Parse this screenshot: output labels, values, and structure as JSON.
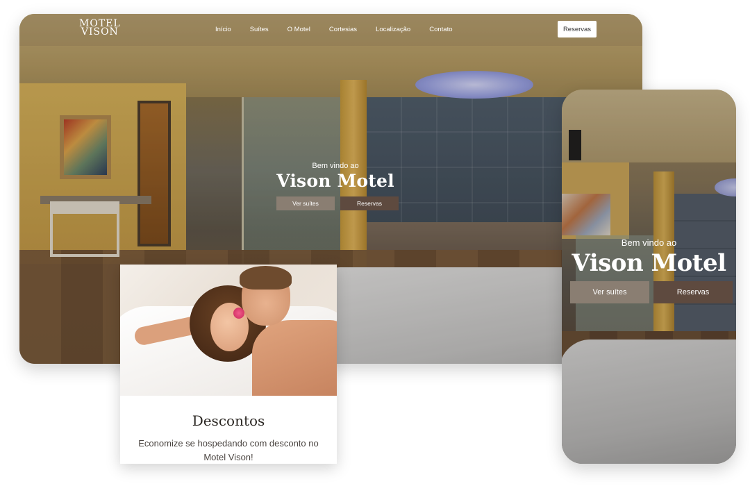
{
  "desktop": {
    "logo": {
      "line1": "MOTEL",
      "line2": "VISON"
    },
    "nav": [
      "Início",
      "Suítes",
      "O Motel",
      "Cortesias",
      "Localização",
      "Contato"
    ],
    "reserve_button": "Reservas",
    "hero": {
      "subtitle": "Bem vindo ao",
      "title": "Vison Motel",
      "buttons": [
        "Ver suítes",
        "Reservas"
      ]
    }
  },
  "card": {
    "title": "Descontos",
    "text": "Economize se hospedando com desconto no Motel Vison!"
  },
  "mobile": {
    "hero": {
      "subtitle": "Bem vindo ao",
      "title": "Vison Motel",
      "buttons": [
        "Ver suítes",
        "Reservas"
      ]
    }
  },
  "colors": {
    "btn_gray": "#8a7e72",
    "btn_brown": "#5e4a3f",
    "card_title": "#2a2622"
  }
}
